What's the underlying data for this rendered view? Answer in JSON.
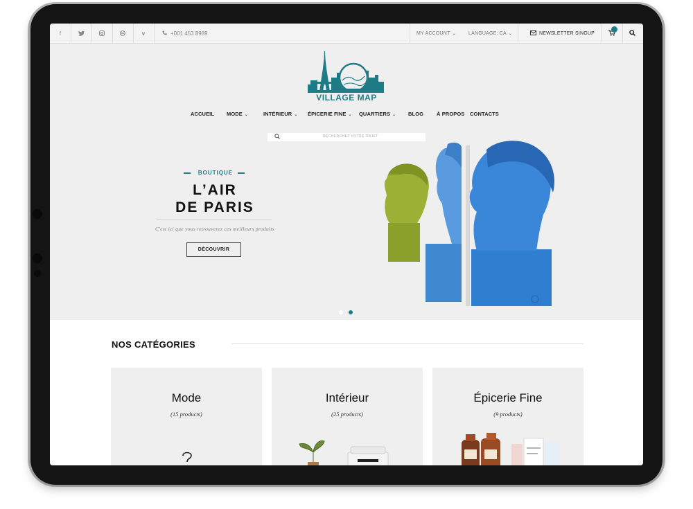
{
  "topbar": {
    "social_icons": [
      "facebook-icon",
      "twitter-icon",
      "instagram-icon",
      "dribbble-icon",
      "vimeo-icon"
    ],
    "social_glyphs": [
      "f",
      "t",
      "◎",
      "⊛",
      "v"
    ],
    "phone": "+001 453 8989",
    "my_account": "MY ACCOUNT",
    "language": "LANGUAGE: CA",
    "newsletter": "NEWSLETTER SINGUP"
  },
  "brand": {
    "name": "VILLAGE MAP",
    "accent": "#1f7c86"
  },
  "nav": {
    "items": [
      {
        "label": "ACCUEIL",
        "dropdown": false
      },
      {
        "label": "MODE",
        "dropdown": true
      },
      {
        "label": "INTÉRIEUR",
        "dropdown": true
      },
      {
        "label": "ÉPICERIE FINE",
        "dropdown": true
      },
      {
        "label": "QUARTIERS",
        "dropdown": true
      },
      {
        "label": "BLOG",
        "dropdown": false
      },
      {
        "label": "À PROPOS",
        "dropdown": false
      },
      {
        "label": "CONTACTS",
        "dropdown": false
      }
    ]
  },
  "search": {
    "placeholder": "RECHERCHEZ VOTRE OBJET"
  },
  "hero": {
    "eyebrow": "BOUTIQUE",
    "title_line1": "L’AIR",
    "title_line2": "DE PARIS",
    "subtitle": "C'est ici que vous retrouverez ces meilleurs produits",
    "cta": "DÉCOUVRIR",
    "slides_total": 2,
    "active_slide": 2
  },
  "categories": {
    "heading": "NOS CATÉGORIES",
    "items": [
      {
        "title": "Mode",
        "count": "(15 products)"
      },
      {
        "title": "Intérieur",
        "count": "(25 products)"
      },
      {
        "title": "Épicerie Fine",
        "count": "(9 products)"
      }
    ]
  }
}
